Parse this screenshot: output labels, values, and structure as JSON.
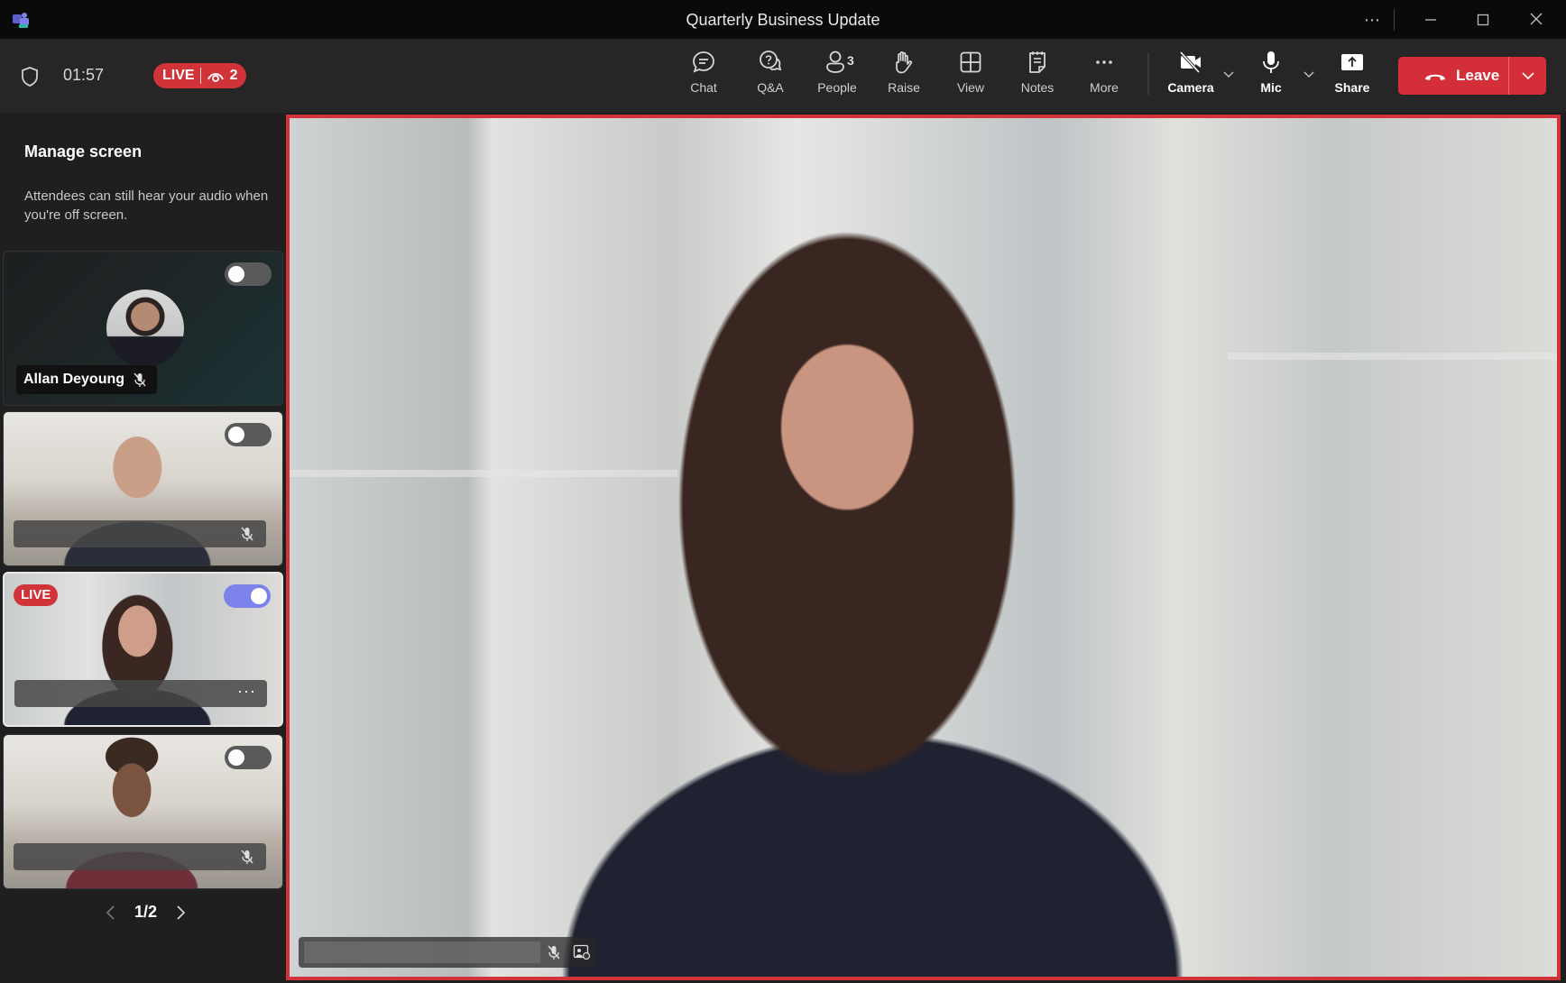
{
  "window": {
    "title": "Quarterly Business Update",
    "controls": [
      "more-options",
      "minimize",
      "maximize",
      "close"
    ]
  },
  "toolbar": {
    "timer": "01:57",
    "live_label": "LIVE",
    "viewer_count": "2",
    "tools": [
      {
        "id": "chat",
        "label": "Chat",
        "icon": "chat-icon"
      },
      {
        "id": "qa",
        "label": "Q&A",
        "icon": "qa-icon"
      },
      {
        "id": "people",
        "label": "People",
        "icon": "people-icon",
        "count": "3"
      },
      {
        "id": "raise",
        "label": "Raise",
        "icon": "raise-hand-icon"
      },
      {
        "id": "view",
        "label": "View",
        "icon": "grid-view-icon"
      },
      {
        "id": "notes",
        "label": "Notes",
        "icon": "notes-icon"
      },
      {
        "id": "more",
        "label": "More",
        "icon": "more-icon"
      }
    ],
    "camera": {
      "label": "Camera",
      "state": "off"
    },
    "mic": {
      "label": "Mic",
      "state": "on"
    },
    "share": {
      "label": "Share"
    },
    "leave": {
      "label": "Leave",
      "color": "#d42f38"
    }
  },
  "sidebar": {
    "title": "Manage screen",
    "description": "Attendees can still hear your audio when you're off screen.",
    "tiles": [
      {
        "name": "Allan Deyoung",
        "type": "avatar",
        "on_screen": false,
        "muted": true,
        "live": false
      },
      {
        "name": "",
        "type": "video",
        "on_screen": false,
        "muted": true,
        "live": false
      },
      {
        "name": "",
        "type": "video",
        "on_screen": true,
        "muted": false,
        "live": true,
        "live_label": "LIVE"
      },
      {
        "name": "",
        "type": "video",
        "on_screen": false,
        "muted": true,
        "live": false
      }
    ],
    "pager": {
      "current": "1/2"
    }
  },
  "main_video": {
    "border_color": "#d13438",
    "muted": true
  },
  "colors": {
    "live_red": "#d13438",
    "toggle_on": "#7b83eb",
    "bg": "#1f1f1f"
  }
}
